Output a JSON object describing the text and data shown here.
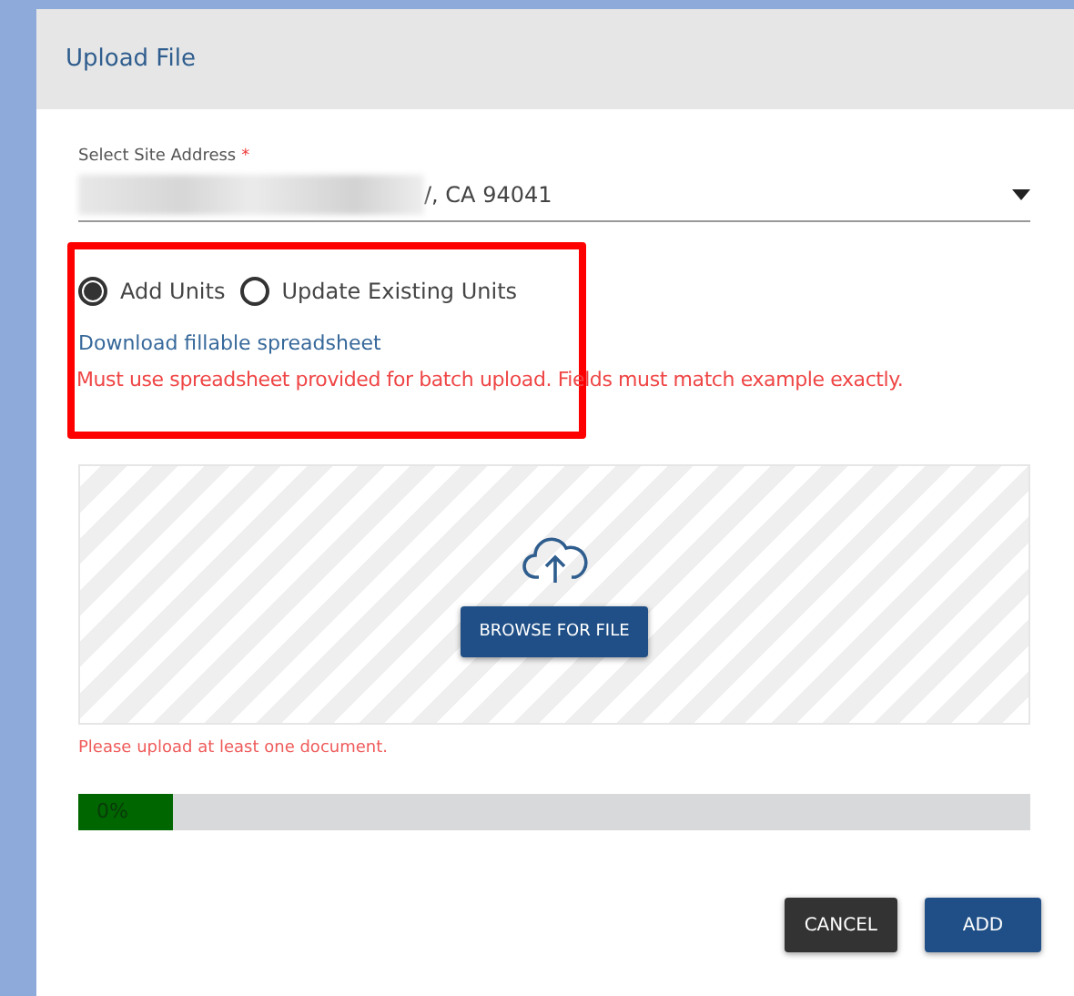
{
  "window": {
    "title": "Upload File"
  },
  "site_address": {
    "label": "Select Site Address",
    "required_mark": "*",
    "value": "/, CA 94041"
  },
  "upload_mode": [
    {
      "label": "Add Units",
      "selected": true
    },
    {
      "label": "Update Existing Units",
      "selected": false
    }
  ],
  "download_link": "Download fillable spreadsheet",
  "warning": "Must use spreadsheet provided for batch upload. Fields must match example exactly.",
  "dropzone": {
    "button": "BROWSE FOR FILE"
  },
  "error": "Please upload at least one document.",
  "progress": {
    "level": 0.1,
    "reading": "0%"
  },
  "buttons": [
    {
      "kind": "secondary",
      "label": "CANCEL"
    },
    {
      "kind": "primary",
      "label": "ADD"
    }
  ]
}
